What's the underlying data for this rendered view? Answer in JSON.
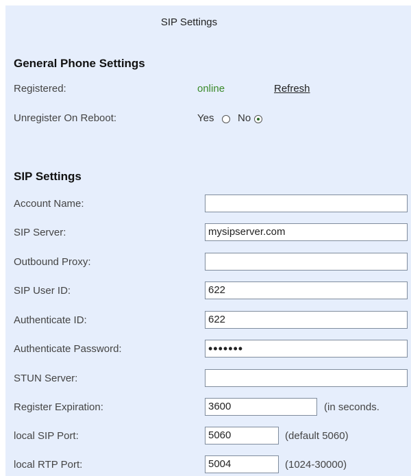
{
  "page_title": "SIP Settings",
  "general": {
    "title": "General Phone Settings",
    "registered_label": "Registered:",
    "registered_status": "online",
    "refresh_label": "Refresh",
    "unregister_label": "Unregister On Reboot:",
    "yes_label": "Yes",
    "no_label": "No",
    "unregister_selected": "No"
  },
  "sip": {
    "title": "SIP Settings",
    "account_name": {
      "label": "Account Name:",
      "value": ""
    },
    "sip_server": {
      "label": "SIP Server:",
      "value": "mysipserver.com"
    },
    "outbound_proxy": {
      "label": "Outbound Proxy:",
      "value": ""
    },
    "sip_user_id": {
      "label": "SIP User ID:",
      "value": "622"
    },
    "authenticate_id": {
      "label": "Authenticate ID:",
      "value": "622"
    },
    "authenticate_password": {
      "label": "Authenticate Password:",
      "value": "•••••••"
    },
    "stun_server": {
      "label": "STUN Server:",
      "value": ""
    },
    "register_expiration": {
      "label": "Register Expiration:",
      "value": "3600",
      "hint": "(in seconds."
    },
    "local_sip_port": {
      "label": "local SIP Port:",
      "value": "5060",
      "hint": "(default 5060)"
    },
    "local_rtp_port": {
      "label": "local RTP Port:",
      "value": "5004",
      "hint": "(1024-30000)"
    }
  }
}
